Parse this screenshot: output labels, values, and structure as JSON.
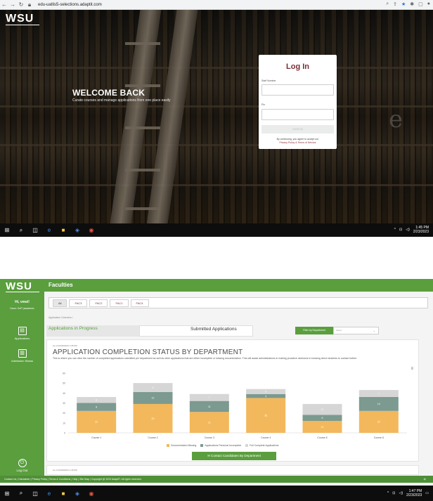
{
  "browser": {
    "url": "edu-uatlis5-selections.adaptit.com"
  },
  "login_page": {
    "logo": "WSU",
    "welcome_title": "WELCOME BACK",
    "welcome_subtitle": "Curate courses and manage applications from one place easily",
    "login_title": "Log In",
    "staff_number_label": "Staff Number",
    "pin_label": "Pin",
    "signin_label": "SIGN IN",
    "consent_text": "By continuing, you agree to accept our",
    "consent_links": "Privacy Policy & Terms of Service"
  },
  "taskbar1": {
    "time": "1:45 PM",
    "date": "2/23/2023"
  },
  "dashboard": {
    "logo": "WSU",
    "greeting": "Hi, vmei!",
    "role": "Dean: OoP (academic",
    "sidebar_items": [
      {
        "label": "Applications"
      },
      {
        "label": "Admission Status"
      }
    ],
    "logout_label": "Log Out",
    "page_title": "Faculties",
    "faculty_tabs": [
      {
        "label": "All",
        "active": true
      },
      {
        "label": "FAC3"
      },
      {
        "label": "FAC2"
      },
      {
        "label": "FAC1"
      },
      {
        "label": "FAC4"
      }
    ],
    "breadcrumb": "Application Overview  /",
    "tab_in_progress": "Applications in Progress",
    "tab_submitted": "Submitted Applications",
    "filter_button": "Filter by Department",
    "filter_placeholder": "Select",
    "as_of": "As of 02/23/2023 1:45 PM",
    "card_title": "APPLICATION COMPLETION STATUS BY DEPARTMENT",
    "card_description": "This is where you can view the number of completed applications submitted per department as well as other applications that are either incomplete or missing documentation. This will assist administrations in making proactive decisions in knowing which students to contact further.",
    "contact_button": "Contact Candidates By Department",
    "as_of_2": "As of 02/23/2023 1:45 PM",
    "footer": "Contact Us | Disclaimer | Privacy Policy | Terms & Conditions | Help | Site Map | Copyright @ 2023 AdaptIT. All rights reserved."
  },
  "taskbar2": {
    "time": "1:47 PM",
    "date": "2/23/2023"
  },
  "colors": {
    "brand_green": "#5a9e3e",
    "login_title": "#7a2c36",
    "series_missing": "#f3b85c",
    "series_incomplete": "#7c9a8f",
    "series_complete": "#d6d6d6"
  },
  "chart_data": {
    "type": "bar",
    "stacked": true,
    "categories": [
      "Course 1",
      "Course 2",
      "Course 3",
      "Course 4",
      "Course 5",
      "Course 6"
    ],
    "series": [
      {
        "name": "Documentation Missing",
        "values": [
          22,
          29,
          21,
          35,
          12,
          22
        ]
      },
      {
        "name": "Applications Personal Incomplete",
        "values": [
          8,
          12,
          11,
          4,
          6,
          14
        ]
      },
      {
        "name": "Full Complete Applications",
        "values": [
          6,
          9,
          7,
          5,
          11,
          7
        ]
      }
    ],
    "ylim": [
      0,
      60
    ],
    "yticks": [
      "0",
      "10",
      "20",
      "30",
      "40",
      "50",
      "60"
    ],
    "legend": "bottom",
    "grid": false
  }
}
